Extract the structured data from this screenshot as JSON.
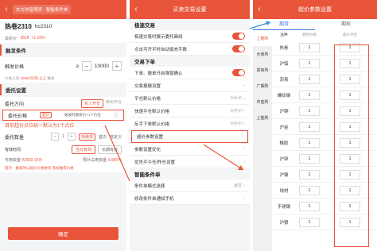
{
  "p1": {
    "header_title": "东方财富期货 - 智能条件单",
    "contract_name": "热卷2310",
    "contract_code": "hc2310",
    "last_price_label": "最新价:",
    "last_price": "3818",
    "change_pct": "+1.03%",
    "sec_trigger": "触发条件",
    "trigger_price_label": "触发价格",
    "trigger_op": "≥",
    "trigger_value": "10000",
    "trigger_hint_prefix": "价格上涨",
    "trigger_hint_accent": "10000元/吨 以上",
    "trigger_hint_suffix": "触发",
    "sec_entrust": "委托设置",
    "direction_label": "委托方向",
    "direction_on": "买入开仓",
    "direction_off": "卖出开仓",
    "price_label": "委托价格",
    "price_tag": "超价",
    "price_desc": "触发时最新价+1个价位",
    "red_note": "目前超价点位统一默认为1个点位",
    "qty_label": "委托数量",
    "qty_value": "1",
    "qty_opts": [
      "持续单",
      "首次",
      "自定义"
    ],
    "qty_on": "持续单",
    "valid_label": "有效时间",
    "valid_opts": [
      "当日有效",
      "长期有效"
    ],
    "avail_label": "可用资金",
    "avail_value": "¥2669.19元",
    "est_label": "预计占用资金",
    "est_value": "4,965元",
    "tip": "提示：触发时以超价价格委托 系统推荐价格",
    "confirm": "确定"
  },
  "p2": {
    "header_title": "买卖交易设置",
    "sec1": "极速交易",
    "items1": [
      {
        "label": "极速交易时展示委托画线",
        "toggle": true
      },
      {
        "label": "点击可开平时自动填充手数",
        "toggle": true
      }
    ],
    "sec2": "交易下单",
    "items2": [
      {
        "label": "下单、撤单开启弹窗确认",
        "right": ""
      },
      {
        "label": "交易报撤设置",
        "right": ""
      },
      {
        "label": "平仓默认价格",
        "right": "对手价"
      },
      {
        "label": "快速平仓默认价格",
        "right": "对手价"
      },
      {
        "label": "反手下单默认价格",
        "right": "对手价"
      },
      {
        "label": "超价参数设置",
        "right": ""
      },
      {
        "label": "参数设置优化",
        "right": ""
      },
      {
        "label": "优先平今仓/昨仓设置",
        "right": ""
      }
    ],
    "sec3": "智能条件单",
    "items3": [
      {
        "label": "条件单模式选择",
        "right": "触发"
      },
      {
        "label": "修改条件单通知手机",
        "right": ""
      }
    ]
  },
  "p3": {
    "header_title": "超价参数设置",
    "tabs": [
      "期货",
      "期权"
    ],
    "exchanges": [
      "上期所",
      "大商所",
      "郑商所",
      "广期所",
      "中金所",
      "上能所"
    ],
    "headers": [
      "品种",
      "委托价格",
      "超价点位"
    ],
    "rows": [
      {
        "name": "热卷",
        "a": "1",
        "b": "1"
      },
      {
        "name": "沪铝",
        "a": "1",
        "b": "1"
      },
      {
        "name": "沥青",
        "a": "1",
        "b": "1"
      },
      {
        "name": "螺纹钢",
        "a": "1",
        "b": "1"
      },
      {
        "name": "沪铜",
        "a": "1",
        "b": "1"
      },
      {
        "name": "沪金",
        "a": "1",
        "b": "1"
      },
      {
        "name": "橡胶",
        "a": "1",
        "b": "1"
      },
      {
        "name": "沪锌",
        "a": "1",
        "b": "1"
      },
      {
        "name": "沪镍",
        "a": "1",
        "b": "1"
      },
      {
        "name": "线材",
        "a": "1",
        "b": "1"
      },
      {
        "name": "不锈钢",
        "a": "1",
        "b": "1"
      },
      {
        "name": "沪银",
        "a": "1",
        "b": "1"
      }
    ]
  }
}
